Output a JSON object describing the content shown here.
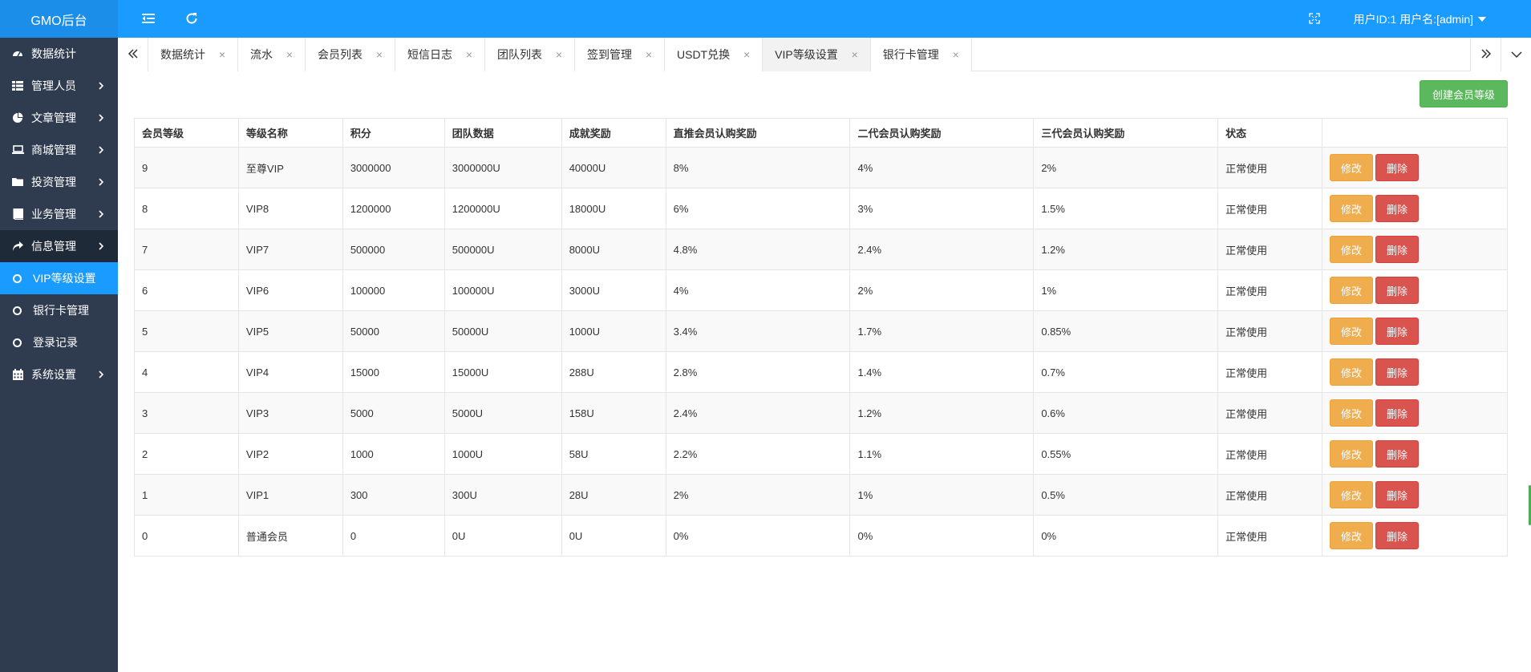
{
  "brand": "GMO后台",
  "sidebar": {
    "items": [
      {
        "label": "数据统计",
        "icon": "dashboard-icon"
      },
      {
        "label": "管理人员",
        "icon": "grid-icon"
      },
      {
        "label": "文章管理",
        "icon": "pie-chart-icon"
      },
      {
        "label": "商城管理",
        "icon": "laptop-icon"
      },
      {
        "label": "投资管理",
        "icon": "folder-icon"
      },
      {
        "label": "业务管理",
        "icon": "book-icon"
      },
      {
        "label": "信息管理",
        "icon": "share-icon"
      }
    ],
    "subitems": [
      {
        "label": "VIP等级设置"
      },
      {
        "label": "银行卡管理"
      },
      {
        "label": "登录记录"
      }
    ],
    "settings": {
      "label": "系统设置",
      "icon": "calendar-icon"
    }
  },
  "topbar": {
    "user": "用户ID:1 用户名:[admin]"
  },
  "tabs": [
    {
      "label": "数据统计"
    },
    {
      "label": "流水"
    },
    {
      "label": "会员列表"
    },
    {
      "label": "短信日志"
    },
    {
      "label": "团队列表"
    },
    {
      "label": "签到管理"
    },
    {
      "label": "USDT兑换"
    },
    {
      "label": "VIP等级设置"
    },
    {
      "label": "银行卡管理"
    }
  ],
  "tab_close": "×",
  "actions": {
    "create": "创建会员等级",
    "edit": "修改",
    "delete": "删除"
  },
  "table": {
    "headers": [
      "会员等级",
      "等级名称",
      "积分",
      "团队数据",
      "成就奖励",
      "直推会员认购奖励",
      "二代会员认购奖励",
      "三代会员认购奖励",
      "状态"
    ],
    "rows": [
      [
        "9",
        "至尊VIP",
        "3000000",
        "3000000U",
        "40000U",
        "8%",
        "4%",
        "2%",
        "正常使用"
      ],
      [
        "8",
        "VIP8",
        "1200000",
        "1200000U",
        "18000U",
        "6%",
        "3%",
        "1.5%",
        "正常使用"
      ],
      [
        "7",
        "VIP7",
        "500000",
        "500000U",
        "8000U",
        "4.8%",
        "2.4%",
        "1.2%",
        "正常使用"
      ],
      [
        "6",
        "VIP6",
        "100000",
        "100000U",
        "3000U",
        "4%",
        "2%",
        "1%",
        "正常使用"
      ],
      [
        "5",
        "VIP5",
        "50000",
        "50000U",
        "1000U",
        "3.4%",
        "1.7%",
        "0.85%",
        "正常使用"
      ],
      [
        "4",
        "VIP4",
        "15000",
        "15000U",
        "288U",
        "2.8%",
        "1.4%",
        "0.7%",
        "正常使用"
      ],
      [
        "3",
        "VIP3",
        "5000",
        "5000U",
        "158U",
        "2.4%",
        "1.2%",
        "0.6%",
        "正常使用"
      ],
      [
        "2",
        "VIP2",
        "1000",
        "1000U",
        "58U",
        "2.2%",
        "1.1%",
        "0.55%",
        "正常使用"
      ],
      [
        "1",
        "VIP1",
        "300",
        "300U",
        "28U",
        "2%",
        "1%",
        "0.5%",
        "正常使用"
      ],
      [
        "0",
        "普通会员",
        "0",
        "0U",
        "0U",
        "0%",
        "0%",
        "0%",
        "正常使用"
      ]
    ]
  },
  "colors": {
    "topbar": "#1a9bff",
    "brand": "#1a8ee8",
    "sidebar": "#2f3c50",
    "active_sub": "#1a9bff",
    "create": "#5cb85c",
    "edit": "#f0ad4e",
    "delete": "#d9534f"
  }
}
